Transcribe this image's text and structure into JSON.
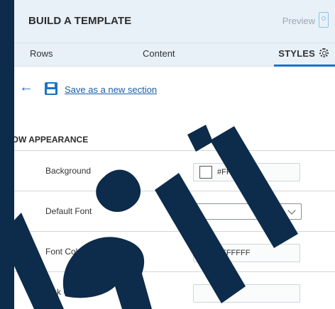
{
  "header": {
    "title": "BUILD A TEMPLATE",
    "preview_label": "Preview"
  },
  "tabs": [
    {
      "label": "Rows"
    },
    {
      "label": "Content"
    },
    {
      "label": "STYLES",
      "active": true
    }
  ],
  "save_link": "Save as a new section",
  "section": {
    "title": "ROW APPEARANCE"
  },
  "fields": {
    "background": {
      "label": "Background",
      "value": "#FFFFFF"
    },
    "default_font": {
      "label": "Default Font",
      "value": ""
    },
    "font_color": {
      "label": "Font Color",
      "value": "#FFFFFF"
    },
    "link_color": {
      "label": "Link Color",
      "value": ""
    }
  },
  "colors": {
    "accent": "#1a73c9",
    "header_bg": "#e8f1f8",
    "backdrop": "#0d2b4a"
  }
}
